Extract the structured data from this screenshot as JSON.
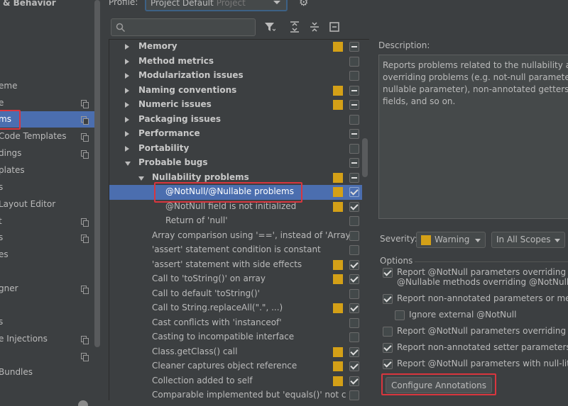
{
  "sidebar": {
    "title": "& Behavior",
    "items": [
      {
        "label": "eme",
        "copy": false,
        "selected": false
      },
      {
        "label": "e",
        "copy": true,
        "selected": false
      },
      {
        "label": "ms",
        "copy": true,
        "selected": true
      },
      {
        "label": "Code Templates",
        "copy": true,
        "selected": false
      },
      {
        "label": "dings",
        "copy": true,
        "selected": false
      },
      {
        "label": "plates",
        "copy": false,
        "selected": false
      },
      {
        "label": "s",
        "copy": false,
        "selected": false
      },
      {
        "label": "Layout Editor",
        "copy": false,
        "selected": false
      },
      {
        "label": "t",
        "copy": true,
        "selected": false
      },
      {
        "label": "s",
        "copy": true,
        "selected": false
      },
      {
        "label": "es",
        "copy": false,
        "selected": false
      },
      {
        "label": "",
        "copy": false,
        "selected": false
      },
      {
        "label": "gner",
        "copy": true,
        "selected": false
      },
      {
        "label": "",
        "copy": false,
        "selected": false
      },
      {
        "label": "s",
        "copy": false,
        "selected": false
      },
      {
        "label": "e Injections",
        "copy": true,
        "selected": false
      },
      {
        "label": "",
        "copy": true,
        "selected": false
      },
      {
        "label": "Bundles",
        "copy": false,
        "selected": false
      }
    ]
  },
  "profile": {
    "label": "Profile:",
    "value": "Project Default",
    "sub": "Project"
  },
  "search": {
    "placeholder": ""
  },
  "tree": {
    "rows": [
      {
        "label": "Memory",
        "indent": 0,
        "expander": "right",
        "bold": true,
        "severity": true,
        "check": "partial"
      },
      {
        "label": "Method metrics",
        "indent": 0,
        "expander": "right",
        "bold": true,
        "severity": false,
        "check": "none"
      },
      {
        "label": "Modularization issues",
        "indent": 0,
        "expander": "right",
        "bold": true,
        "severity": false,
        "check": "none"
      },
      {
        "label": "Naming conventions",
        "indent": 0,
        "expander": "right",
        "bold": true,
        "severity": true,
        "check": "partial"
      },
      {
        "label": "Numeric issues",
        "indent": 0,
        "expander": "right",
        "bold": true,
        "severity": true,
        "check": "partial"
      },
      {
        "label": "Packaging issues",
        "indent": 0,
        "expander": "right",
        "bold": true,
        "severity": false,
        "check": "none"
      },
      {
        "label": "Performance",
        "indent": 0,
        "expander": "right",
        "bold": true,
        "severity": false,
        "check": "partial"
      },
      {
        "label": "Portability",
        "indent": 0,
        "expander": "right",
        "bold": true,
        "severity": false,
        "check": "none"
      },
      {
        "label": "Probable bugs",
        "indent": 0,
        "expander": "down",
        "bold": true,
        "severity": false,
        "check": "partial"
      },
      {
        "label": "Nullability problems",
        "indent": 1,
        "expander": "down",
        "bold": true,
        "severity": true,
        "check": "partial"
      },
      {
        "label": "@NotNull/@Nullable problems",
        "indent": 2,
        "expander": "none",
        "bold": false,
        "severity": true,
        "check": "checked",
        "selected": true
      },
      {
        "label": "@NotNull field is not initialized",
        "indent": 2,
        "expander": "none",
        "bold": false,
        "severity": true,
        "check": "checked"
      },
      {
        "label": "Return of 'null'",
        "indent": 2,
        "expander": "none",
        "bold": false,
        "severity": false,
        "check": "none"
      },
      {
        "label": "Array comparison using '==', instead of 'Array",
        "indent": 1,
        "expander": "none",
        "bold": false,
        "severity": false,
        "check": "none"
      },
      {
        "label": "'assert' statement condition is constant",
        "indent": 1,
        "expander": "none",
        "bold": false,
        "severity": false,
        "check": "none"
      },
      {
        "label": "'assert' statement with side effects",
        "indent": 1,
        "expander": "none",
        "bold": false,
        "severity": true,
        "check": "checked"
      },
      {
        "label": "Call to 'toString()' on array",
        "indent": 1,
        "expander": "none",
        "bold": false,
        "severity": true,
        "check": "checked"
      },
      {
        "label": "Call to default 'toString()'",
        "indent": 1,
        "expander": "none",
        "bold": false,
        "severity": false,
        "check": "none"
      },
      {
        "label": "Call to String.replaceAll(\".\", ...)",
        "indent": 1,
        "expander": "none",
        "bold": false,
        "severity": true,
        "check": "checked"
      },
      {
        "label": "Cast conflicts with 'instanceof'",
        "indent": 1,
        "expander": "none",
        "bold": false,
        "severity": false,
        "check": "none"
      },
      {
        "label": "Casting to incompatible interface",
        "indent": 1,
        "expander": "none",
        "bold": false,
        "severity": false,
        "check": "none"
      },
      {
        "label": "Class.getClass() call",
        "indent": 1,
        "expander": "none",
        "bold": false,
        "severity": true,
        "check": "checked"
      },
      {
        "label": "Cleaner captures object reference",
        "indent": 1,
        "expander": "none",
        "bold": false,
        "severity": true,
        "check": "checked"
      },
      {
        "label": "Collection added to self",
        "indent": 1,
        "expander": "none",
        "bold": false,
        "severity": true,
        "check": "checked"
      },
      {
        "label": "Comparable implemented but 'equals()' not c",
        "indent": 1,
        "expander": "none",
        "bold": false,
        "severity": false,
        "check": "none"
      }
    ]
  },
  "description": {
    "label": "Description:",
    "lines": [
      "Reports problems related to the nullability anno",
      "overriding problems (e.g. not-null parameter ov",
      "nullable parameter), non-annotated getters of a",
      "fields, and so on."
    ]
  },
  "severity": {
    "label": "Severity:",
    "value": "Warning",
    "scope": "In All Scopes"
  },
  "options": {
    "label": "Options",
    "items": [
      {
        "text": "Report @NotNull parameters overriding @N",
        "checked": true
      },
      {
        "text": "Report non-annotated parameters or metho",
        "checked": true
      },
      {
        "text": "Ignore external @NotNull",
        "checked": false
      },
      {
        "text": "Report @NotNull parameters overriding nor",
        "checked": false
      },
      {
        "text": "Report non-annotated setter parameters or",
        "checked": true
      },
      {
        "text": "Report @NotNull parameters with null-litera",
        "checked": true
      }
    ],
    "item1_line2": "@Nullable methods overriding @NotNull"
  },
  "configure_button": {
    "label": "Configure Annotations"
  },
  "colors": {
    "selection": "#4b6eaf",
    "warning": "#d4a017",
    "highlight": "#d9363e",
    "background": "#3c3f41"
  }
}
